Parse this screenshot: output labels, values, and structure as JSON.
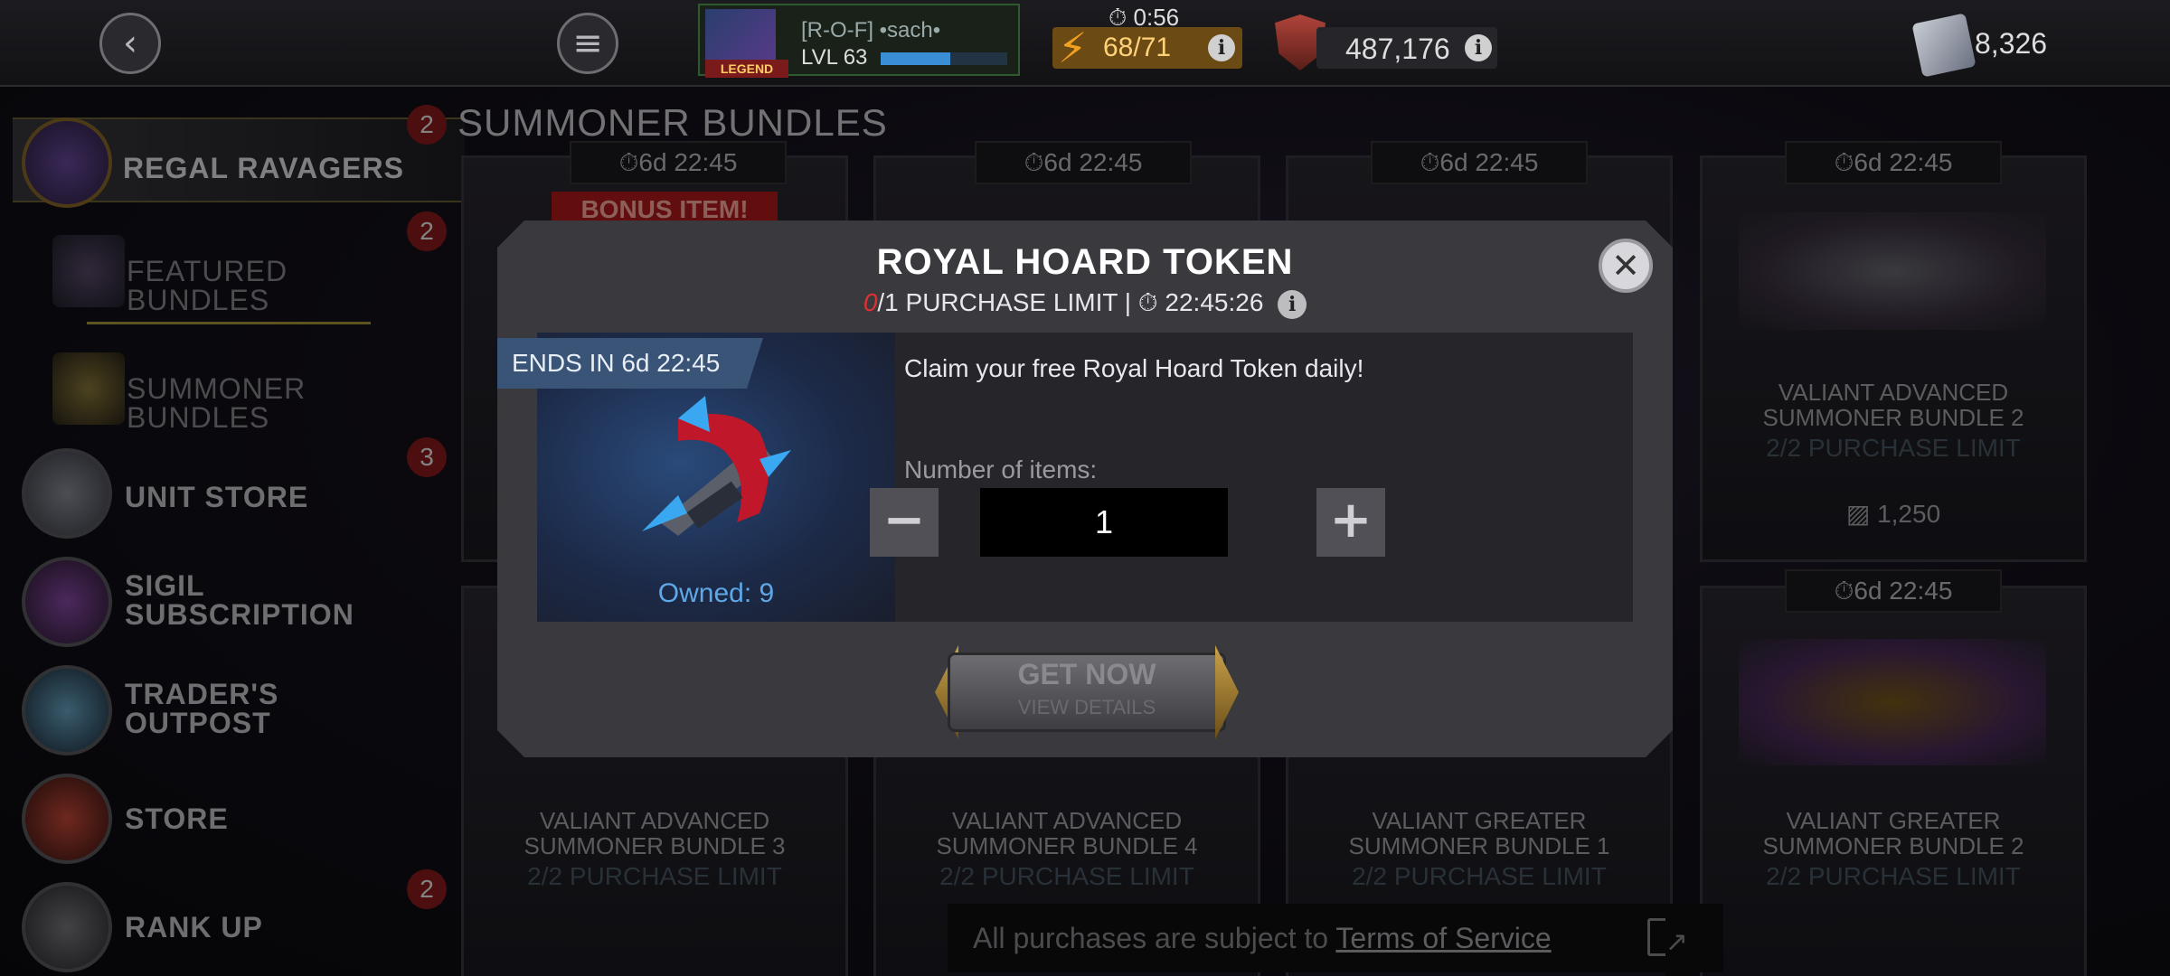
{
  "topbar": {
    "profile": {
      "name": "[R-O-F] •sach•",
      "level": "LVL 63",
      "legend_tag": "LEGEND",
      "xp_fraction": 0.55
    },
    "energy": {
      "timer": "0:56",
      "value": "68/71"
    },
    "rating": {
      "value": "487,176"
    },
    "units": {
      "value": "8,326"
    }
  },
  "sidebar": {
    "items": [
      {
        "label": "REGAL RAVAGERS",
        "badge": "2",
        "selected": true
      },
      {
        "label": "FEATURED BUNDLES",
        "badge": "2"
      },
      {
        "label": "SUMMONER BUNDLES"
      },
      {
        "label": "UNIT STORE",
        "badge": "3"
      },
      {
        "label": "SIGIL\nSUBSCRIPTION"
      },
      {
        "label": "TRADER'S\nOUTPOST"
      },
      {
        "label": "STORE"
      },
      {
        "label": "RANK UP",
        "badge": "2"
      }
    ]
  },
  "main": {
    "section_title": "SUMMONER BUNDLES",
    "bonus_label": "BONUS ITEM!",
    "cards": [
      {
        "timer": "6d 22:45",
        "name": "VALIANT ADVANCED\nSUMMONER BUNDLE 3",
        "limit": "2/2 PURCHASE LIMIT"
      },
      {
        "timer": "6d 22:45",
        "name": "VALIANT ADVANCED\nSUMMONER BUNDLE 4",
        "limit": "2/2 PURCHASE LIMIT"
      },
      {
        "timer": "6d 22:45",
        "name": "VALIANT GREATER\nSUMMONER BUNDLE 1",
        "limit": "2/2 PURCHASE LIMIT"
      },
      {
        "timer": "6d 22:45",
        "name": "VALIANT ADVANCED\nSUMMONER BUNDLE 2",
        "limit": "2/2 PURCHASE LIMIT",
        "price": "1,250"
      },
      {
        "timer": "6d 22:45",
        "name": "VALIANT GREATER\nSUMMONER BUNDLE 2",
        "limit": "2/2 PURCHASE LIMIT"
      }
    ],
    "terms": {
      "prefix": "All purchases are subject to",
      "link": "Terms of Service"
    }
  },
  "modal": {
    "title": "ROYAL HOARD TOKEN",
    "limit_used": "0",
    "limit_text": "/1 PURCHASE LIMIT |",
    "timer": "22:45:26",
    "ends_in": "ENDS IN 6d 22:45",
    "owned": "Owned: 9",
    "description": "Claim your free Royal Hoard Token daily!",
    "qty_label": "Number of items:",
    "qty_value": "1",
    "get_label": "GET NOW",
    "get_sub": "VIEW DETAILS"
  },
  "colors": {
    "accent_red": "#e23030",
    "owned_blue": "#5fa8e8",
    "bonus_red": "#b31a1a"
  }
}
